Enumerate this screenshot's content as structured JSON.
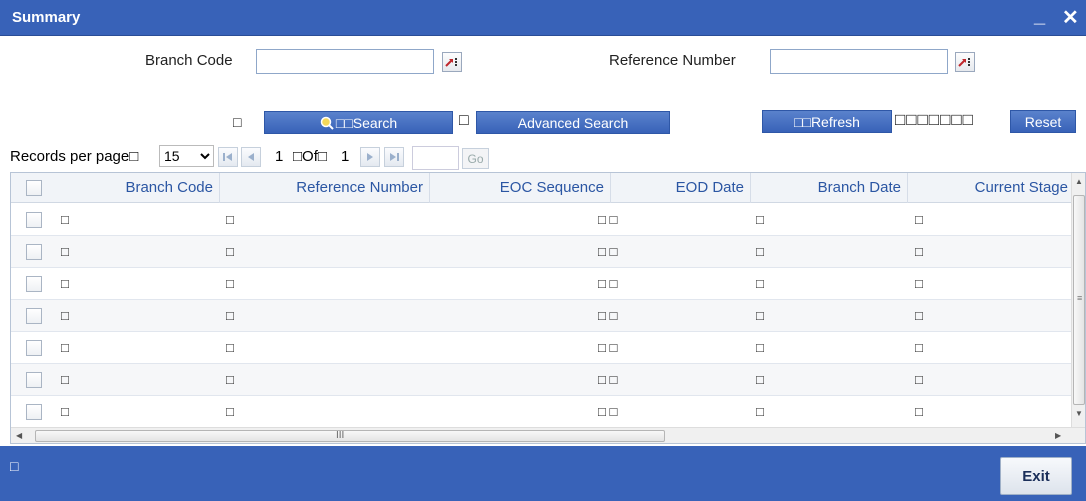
{
  "window": {
    "title": "Summary",
    "minimize_glyph": "_",
    "close_glyph": "✕"
  },
  "criteria": {
    "branch_code_label": "Branch Code",
    "branch_code_value": "",
    "reference_number_label": "Reference Number",
    "reference_number_value": ""
  },
  "toolbar": {
    "search_label": "Search",
    "search_prefix_glyphs": "□□",
    "advanced_search_label": "Advanced Search",
    "refresh_prefix_glyphs": "□□",
    "refresh_label": "Refresh",
    "reset_prefix_glyphs": "□□□□□□□",
    "reset_label": "Reset",
    "sep_glyph": "□"
  },
  "pager": {
    "records_label": "Records per page□",
    "records_per_page": "15",
    "records_options": [
      "15"
    ],
    "current_page": "1",
    "of_label": "□Of□",
    "total_pages": "1",
    "go_label": "Go"
  },
  "grid": {
    "columns": [
      "Branch Code",
      "Reference Number",
      "EOC Sequence",
      "EOD Date",
      "Branch Date",
      "Current Stage"
    ],
    "rows": [
      [
        "□",
        "□",
        "□ □",
        "□",
        "□"
      ],
      [
        "□",
        "□",
        "□ □",
        "□",
        "□"
      ],
      [
        "□",
        "□",
        "□ □",
        "□",
        "□"
      ],
      [
        "□",
        "□",
        "□ □",
        "□",
        "□"
      ],
      [
        "□",
        "□",
        "□ □",
        "□",
        "□"
      ],
      [
        "□",
        "□",
        "□ □",
        "□",
        "□"
      ],
      [
        "□",
        "□",
        "□ □",
        "□",
        "□"
      ]
    ],
    "hscroll_grip": "III",
    "vscroll_grip": "≡"
  },
  "footer": {
    "status_glyph": "□",
    "exit_label": "Exit"
  },
  "colors": {
    "brand_blue": "#3862b8",
    "header_text": "#2b56a3"
  }
}
